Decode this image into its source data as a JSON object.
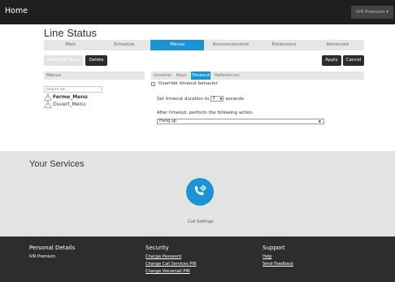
{
  "topbar": {
    "brand": "Home",
    "account": "IVR Premium ▾"
  },
  "page_title": "Line Status",
  "tabs": [
    {
      "label": "Main",
      "active": false
    },
    {
      "label": "Schedule",
      "active": false
    },
    {
      "label": "Menus",
      "active": true
    },
    {
      "label": "Announcements",
      "active": false
    },
    {
      "label": "Extensions",
      "active": false
    },
    {
      "label": "Advanced",
      "active": false
    }
  ],
  "toolbar": {
    "add_label": "Add New Menu",
    "delete_label": "Delete",
    "apply_label": "Apply",
    "cancel_label": "Cancel"
  },
  "menus_panel": {
    "header": "Menus",
    "search_placeholder": "Search for...",
    "items": [
      {
        "label": "Ferme_Menu"
      },
      {
        "label": "Ouvert_Menu"
      }
    ]
  },
  "subtabs": [
    {
      "label": "General",
      "active": false
    },
    {
      "label": "Keys",
      "active": false
    },
    {
      "label": "Timeout",
      "active": true
    },
    {
      "label": "References",
      "active": false
    }
  ],
  "timeout": {
    "override_label": "Override timeout behavior.",
    "duration_prefix": "Set timeout duration to",
    "duration_value": "3",
    "duration_suffix": "seconds.",
    "action_label": "After timeout, perform the following action",
    "action_value": "Hang up"
  },
  "services": {
    "title": "Your Services",
    "call_settings_label": "Call Settings"
  },
  "footer": {
    "col0": {
      "heading": "Personal Details",
      "links": [
        "IVR Premium"
      ]
    },
    "col1": {
      "heading": "Security",
      "links": [
        "Change Password",
        "Change Call Services PIN",
        "Change Voicemail PIN"
      ]
    },
    "col2": {
      "heading": "Support",
      "links": [
        "Help",
        "Send Feedback"
      ]
    }
  },
  "colors": {
    "accent": "#1a94d2",
    "topbar": "#1f1f1f",
    "footer": "#2d2d2d",
    "services_bg": "#e3e3e3"
  },
  "icons": {
    "warning": "warning-icon",
    "call_settings": "phone-gear-icon",
    "caret": "caret-down-icon"
  }
}
